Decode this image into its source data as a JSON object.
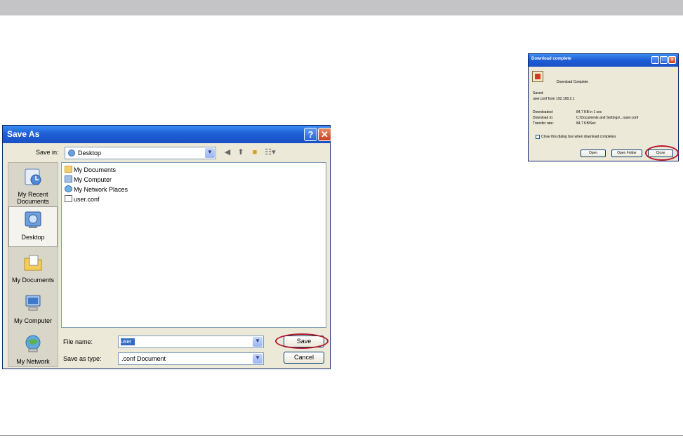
{
  "save_as": {
    "title": "Save As",
    "help_glyph": "?",
    "close_glyph": "✕",
    "save_in_label": "Save in:",
    "save_in_value": "Desktop",
    "places": [
      {
        "label": "My Recent Documents",
        "icon": "recent-documents-icon"
      },
      {
        "label": "Desktop",
        "icon": "desktop-icon"
      },
      {
        "label": "My Documents",
        "icon": "my-documents-icon"
      },
      {
        "label": "My Computer",
        "icon": "my-computer-icon"
      },
      {
        "label": "My Network",
        "icon": "my-network-icon"
      }
    ],
    "files": [
      "My Documents",
      "My Computer",
      "My Network Places",
      "user.conf"
    ],
    "file_name_label": "File name:",
    "file_name_value": "user",
    "save_as_type_label": "Save as type:",
    "save_as_type_value": ".conf Document",
    "save_button": "Save",
    "cancel_button": "Cancel",
    "highlight_color": "#b3182b"
  },
  "download": {
    "title": "Download complete",
    "heading": "Download Complete",
    "saved_label": "Saved:",
    "saved_value": "user.conf from 192.168.2.1",
    "downloaded_label": "Downloaded:",
    "downloaded_value": "84.7 KB in 1 sec",
    "download_to_label": "Download to:",
    "download_to_value": "C:\\Documents and Settings\\...\\user.conf",
    "transfer_rate_label": "Transfer rate:",
    "transfer_rate_value": "84.7 KB/Sec",
    "checkbox_label": "Close this dialog box when download completes",
    "open_button": "Open",
    "open_folder_button": "Open Folder",
    "close_button": "Close"
  },
  "colors": {
    "xp_title_blue": "#1f5fd6",
    "dialog_face": "#ece9d8",
    "highlight_red": "#b3182b"
  }
}
